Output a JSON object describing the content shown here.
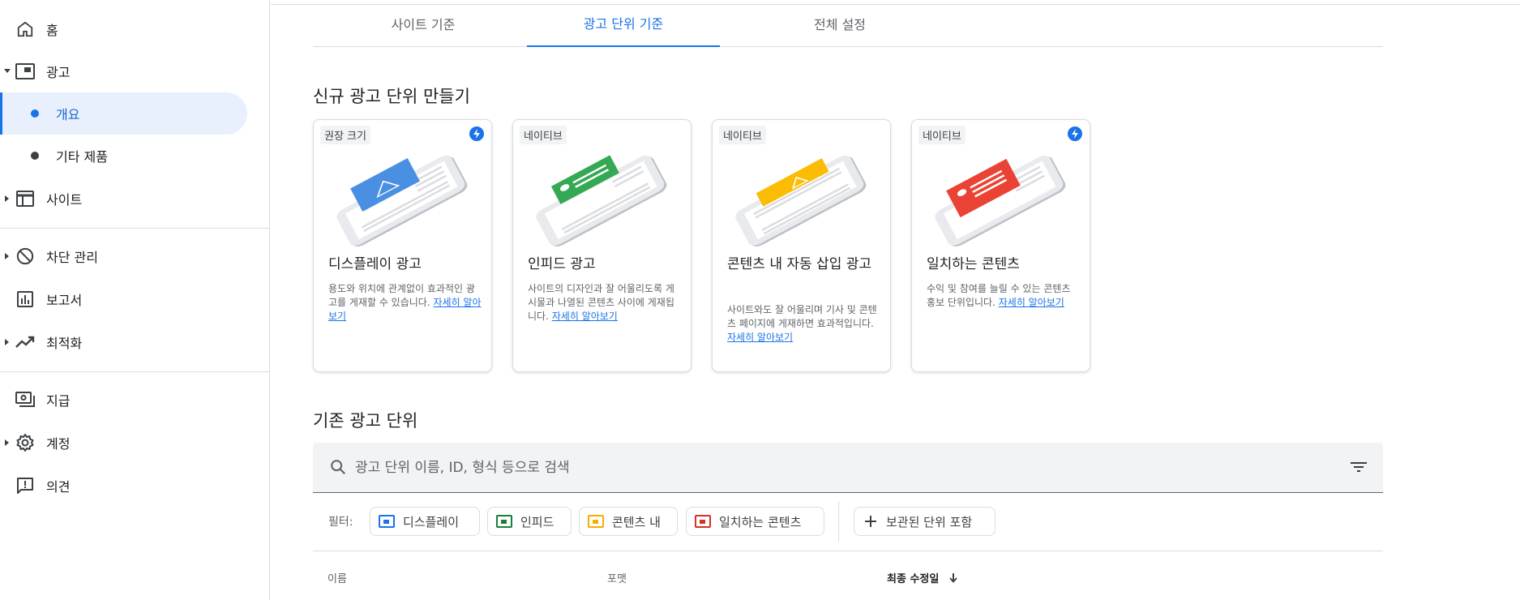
{
  "sidebar": {
    "items": [
      {
        "label": "홈",
        "icon": "home-icon"
      },
      {
        "label": "광고",
        "icon": "ads-icon"
      },
      {
        "label": "개요"
      },
      {
        "label": "기타 제품"
      },
      {
        "label": "사이트",
        "icon": "sites-icon"
      },
      {
        "label": "차단 관리",
        "icon": "block-icon"
      },
      {
        "label": "보고서",
        "icon": "reports-icon"
      },
      {
        "label": "최적화",
        "icon": "trending-icon"
      },
      {
        "label": "지급",
        "icon": "payments-icon"
      },
      {
        "label": "계정",
        "icon": "gear-icon"
      },
      {
        "label": "의견",
        "icon": "feedback-icon"
      }
    ]
  },
  "tabs": [
    {
      "label": "사이트 기준"
    },
    {
      "label": "광고 단위 기준",
      "active": true
    },
    {
      "label": "전체 설정"
    }
  ],
  "new_section_title": "신규 광고 단위 만들기",
  "cards": [
    {
      "badge": "권장 크기",
      "title": "디스플레이 광고",
      "desc": "용도와 위치에 관계없이 효과적인 광고를 게재할 수 있습니다.",
      "link": "자세히 알아보기",
      "color": "#4a90e2"
    },
    {
      "badge": "네이티브",
      "title": "인피드 광고",
      "desc": "사이트의 디자인과 잘 어울리도록 게시물과 나열된 콘텐츠 사이에 게재됩니다.",
      "link": "자세히 알아보기",
      "color": "#34a853"
    },
    {
      "badge": "네이티브",
      "title": "콘텐츠 내 자동 삽입 광고",
      "desc": "사이트와도 잘 어울리며 기사 및 콘텐츠 페이지에 게재하면 효과적입니다.",
      "link": "자세히 알아보기",
      "color": "#fbbc04"
    },
    {
      "badge": "네이티브",
      "title": "일치하는 콘텐츠",
      "desc": "수익 및 참여를 늘릴 수 있는 콘텐츠 홍보 단위입니다.",
      "link": "자세히 알아보기",
      "color": "#ea4335"
    }
  ],
  "existing_section_title": "기존 광고 단위",
  "search": {
    "placeholder": "광고 단위 이름, ID, 형식 등으로 검색"
  },
  "filters": {
    "label": "필터:",
    "chips": [
      {
        "label": "디스플레이",
        "color": "#1a73e8"
      },
      {
        "label": "인피드",
        "color": "#188038"
      },
      {
        "label": "콘텐츠 내",
        "color": "#f9ab00"
      },
      {
        "label": "일치하는 콘텐츠",
        "color": "#d93025"
      }
    ],
    "archived": "보관된 단위 포함"
  },
  "table": {
    "columns": [
      "이름",
      "포맷",
      "최종 수정일"
    ]
  }
}
